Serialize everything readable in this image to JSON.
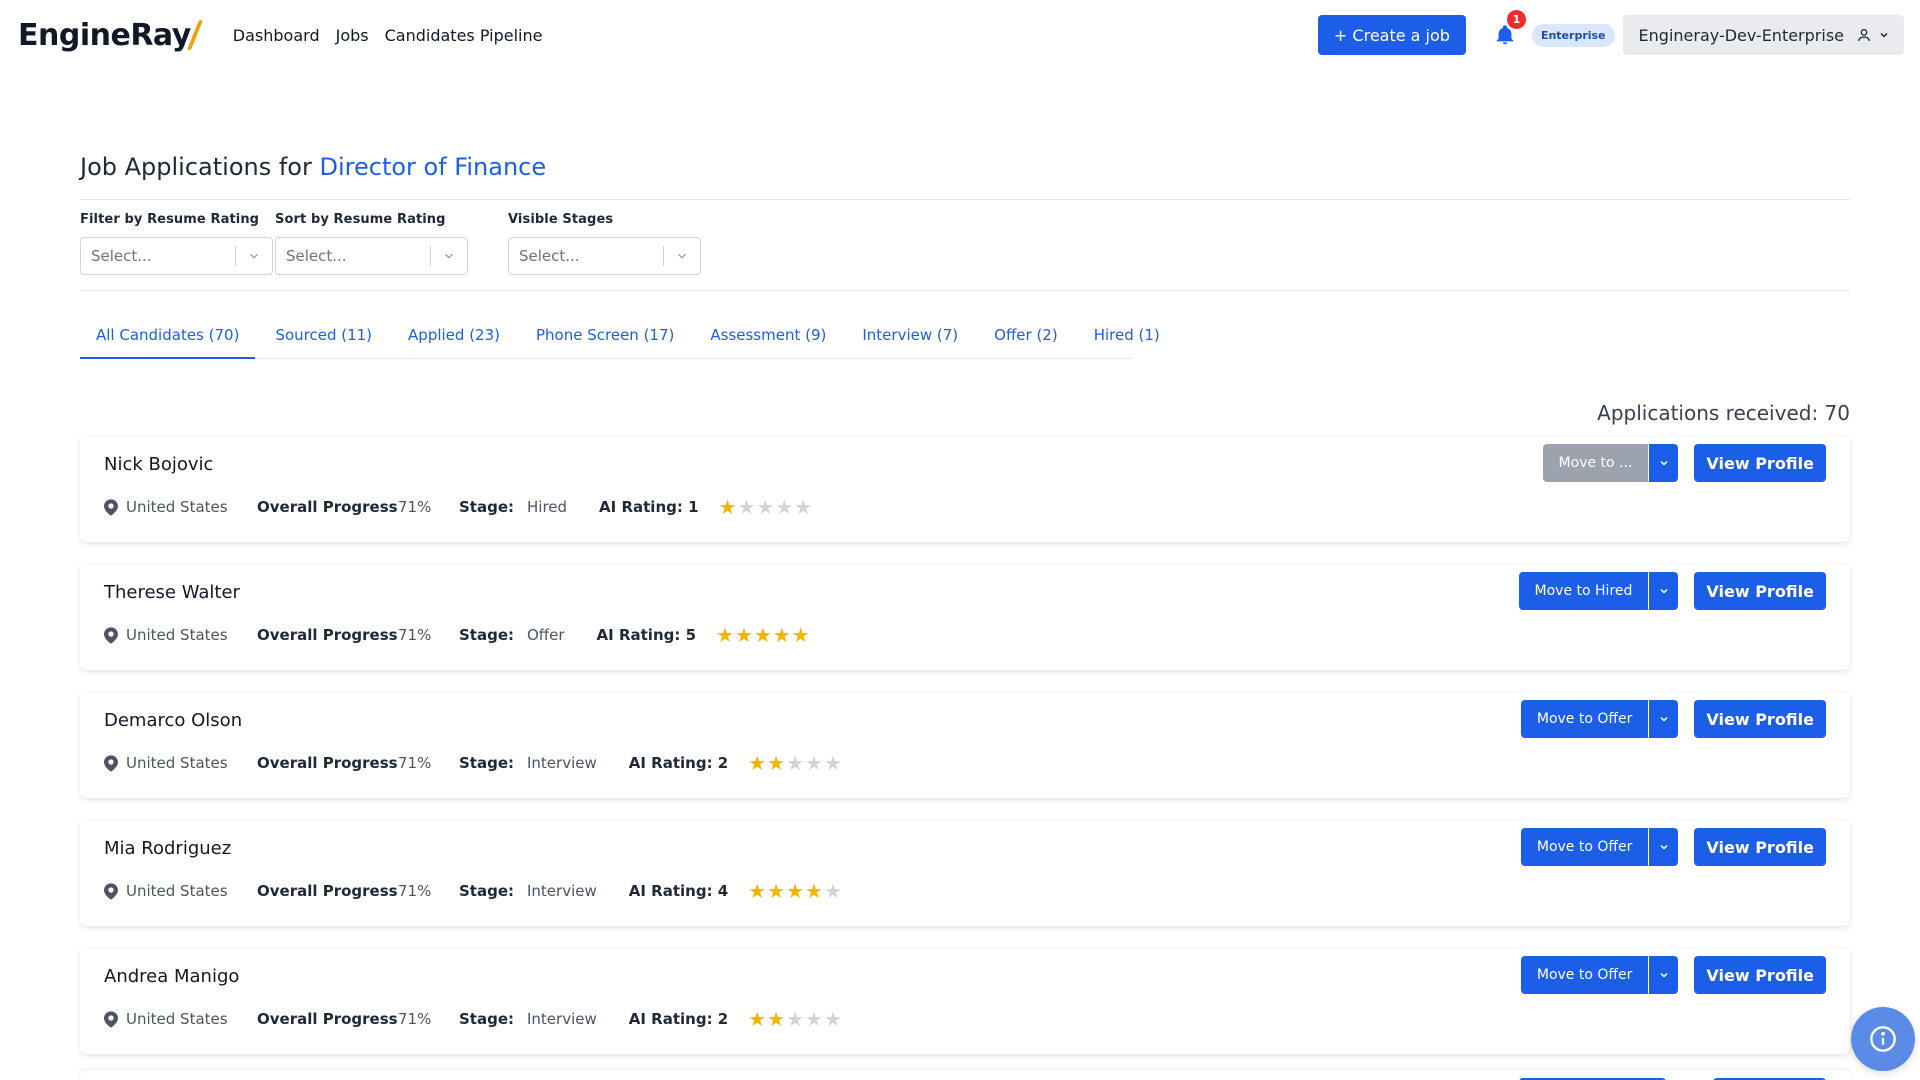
{
  "brand": {
    "logo_text": "EngineRay"
  },
  "nav": {
    "links": [
      "Dashboard",
      "Jobs",
      "Candidates Pipeline"
    ],
    "create_job_label": "+ Create a job",
    "notification_count": "1",
    "plan_badge": "Enterprise",
    "account_name": "Engineray-Dev-Enterprise"
  },
  "header": {
    "title_prefix": "Job Applications for",
    "job_title": "Director of Finance"
  },
  "filters": [
    {
      "label": "Filter by Resume Rating",
      "placeholder": "Select..."
    },
    {
      "label": "Sort by Resume Rating",
      "placeholder": "Select..."
    },
    {
      "label": "Visible Stages",
      "placeholder": "Select..."
    }
  ],
  "tabs": [
    {
      "label": "All Candidates (70)",
      "active": true
    },
    {
      "label": "Sourced (11)",
      "active": false
    },
    {
      "label": "Applied (23)",
      "active": false
    },
    {
      "label": "Phone Screen (17)",
      "active": false
    },
    {
      "label": "Assessment (9)",
      "active": false
    },
    {
      "label": "Interview (7)",
      "active": false
    },
    {
      "label": "Offer (2)",
      "active": false
    },
    {
      "label": "Hired (1)",
      "active": false
    }
  ],
  "applications_received": "Applications received: 70",
  "labels": {
    "overall_progress": "Overall Progress",
    "stage": "Stage:",
    "ai_rating_prefix": "AI Rating:",
    "view_profile": "View Profile"
  },
  "candidates": [
    {
      "name": "Nick Bojovic",
      "location": "United States",
      "progress": "71%",
      "stage": "Hired",
      "ai_rating": 1,
      "move_label": "Move to ...",
      "move_disabled": true
    },
    {
      "name": "Therese Walter",
      "location": "United States",
      "progress": "71%",
      "stage": "Offer",
      "ai_rating": 5,
      "move_label": "Move to Hired",
      "move_disabled": false
    },
    {
      "name": "Demarco Olson",
      "location": "United States",
      "progress": "71%",
      "stage": "Interview",
      "ai_rating": 2,
      "move_label": "Move to Offer",
      "move_disabled": false
    },
    {
      "name": "Mia Rodriguez",
      "location": "United States",
      "progress": "71%",
      "stage": "Interview",
      "ai_rating": 4,
      "move_label": "Move to Offer",
      "move_disabled": false
    },
    {
      "name": "Andrea Manigo",
      "location": "United States",
      "progress": "71%",
      "stage": "Interview",
      "ai_rating": 2,
      "move_label": "Move to Offer",
      "move_disabled": false
    }
  ],
  "colors": {
    "primary": "#1d5ee8",
    "star": "#f4b400",
    "star_empty": "#d1d5db",
    "notification": "#ef2b2b",
    "disabled": "#9ca3af"
  }
}
